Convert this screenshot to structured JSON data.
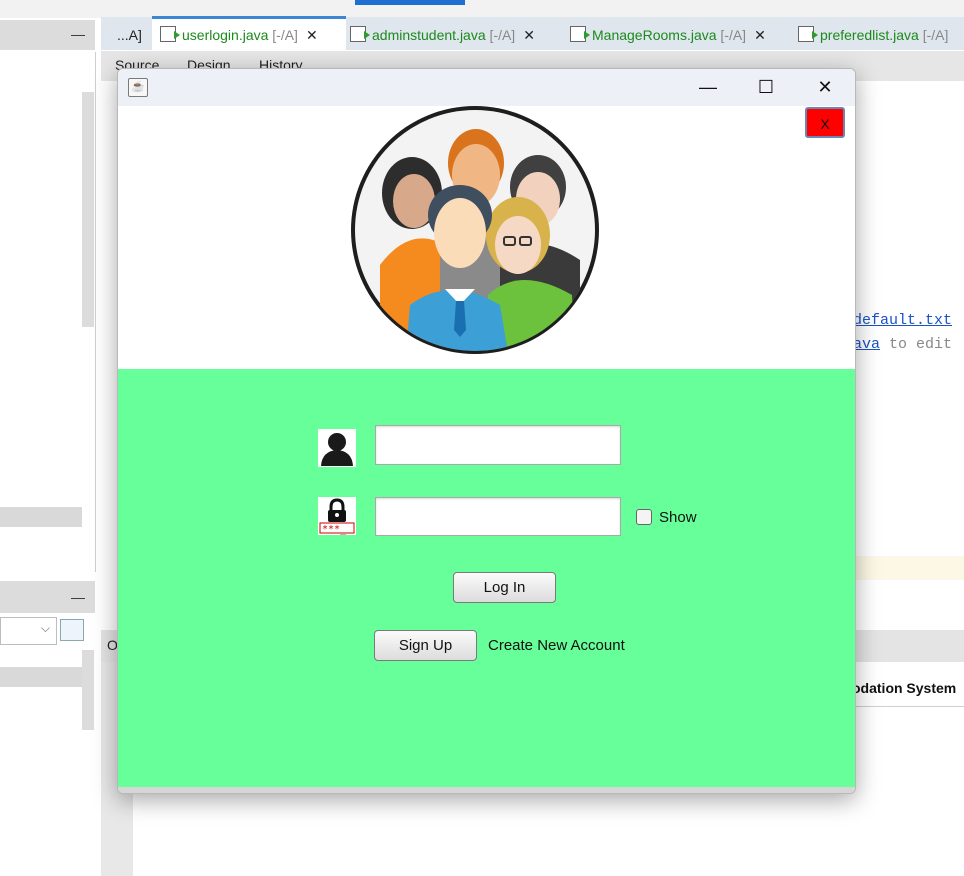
{
  "ide": {
    "tabs": [
      {
        "name": "...A]",
        "suffix": "",
        "active": false
      },
      {
        "name": "userlogin.java",
        "suffix": "[-/A]",
        "active": true
      },
      {
        "name": "adminstudent.java",
        "suffix": "[-/A]",
        "active": false
      },
      {
        "name": "ManageRooms.java",
        "suffix": "[-/A]",
        "active": false
      },
      {
        "name": "preferedlist.java",
        "suffix": "[-/A]",
        "active": false
      }
    ],
    "close_glyph": "✕",
    "view_tabs": [
      "Source",
      "Design",
      "History"
    ],
    "code_line_1": "default.txt",
    "code_line_2_link": "ava",
    "code_line_2_rest": " to edit",
    "output_label": "O",
    "output_line": "odation System",
    "minimize_glyph": "—"
  },
  "dialog": {
    "title_icon": "java-icon",
    "minimize_glyph": "—",
    "maximize_glyph": "☐",
    "close_glyph": "✕",
    "exit_button_label": "X",
    "exit_button_color": "#ff0000",
    "header_image": "group-of-users-icon",
    "form_background": "#66ff99",
    "username_icon": "user-silhouette-icon",
    "password_icon": "lock-password-icon",
    "username_value": "",
    "password_value": "",
    "show_label": "Show",
    "show_checked": false,
    "login_label": "Log In",
    "signup_label": "Sign Up",
    "create_account_label": "Create New Account"
  }
}
